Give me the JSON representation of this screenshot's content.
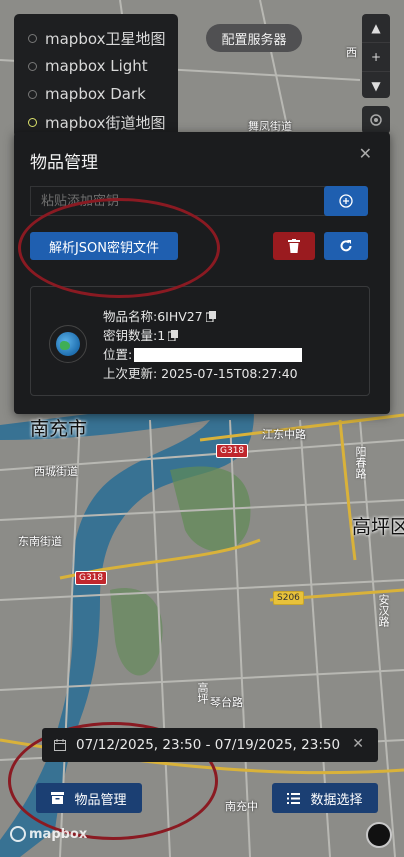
{
  "map_styles": [
    {
      "label": "mapbox卫星地图",
      "selected": false
    },
    {
      "label": "mapbox Light",
      "selected": false
    },
    {
      "label": "mapbox Dark",
      "selected": false
    },
    {
      "label": "mapbox街道地图",
      "selected": true
    }
  ],
  "server_button": "配置服务器",
  "map_labels": {
    "feng": "舞凤街道",
    "nanchong": "南充市",
    "jiangdong": "江东中路",
    "xicheng": "西城街道",
    "dongnan": "东南街道",
    "gaoping": "高坪区",
    "gaoping_district": "高坪",
    "xi": "西",
    "nanchong_right": "南充中",
    "qintai": "琴台路",
    "anhan": "安汉路",
    "yangchun": "阳春路",
    "g318": "G318",
    "s206": "S206"
  },
  "modal": {
    "title": "物品管理",
    "key_placeholder": "粘贴添加密钥",
    "parse_button": "解析JSON密钥文件",
    "item": {
      "name": "物品名称:6IHV27",
      "key_count": "密钥数量:1",
      "location_label": "位置:",
      "last_update": "上次更新: 2025-07-15T08:27:40"
    }
  },
  "date_range": "07/12/2025, 23:50 - 07/19/2025, 23:50",
  "items_button": "物品管理",
  "data_button": "数据选择",
  "mapbox_logo": "mapbox",
  "colors": {
    "primary": "#1f5fb0",
    "danger": "#9a1b1f",
    "annotation": "#8a1a22"
  }
}
